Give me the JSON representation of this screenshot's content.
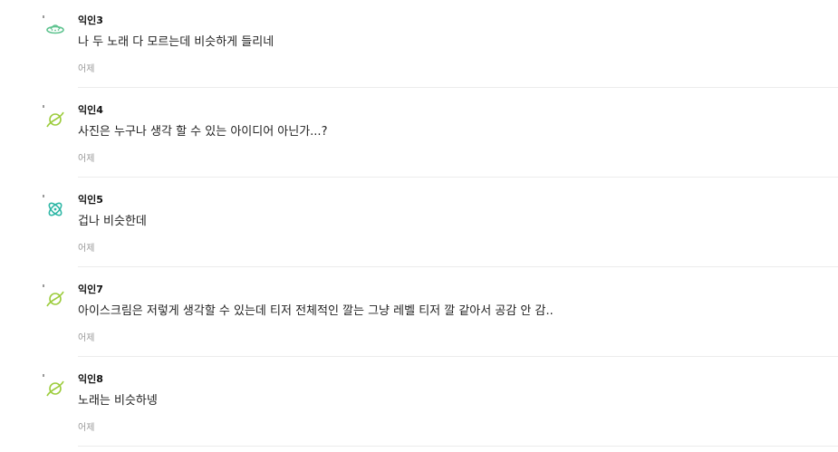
{
  "comments": [
    {
      "author": "익인3",
      "text": "나 두 노래 다 모르는데 비슷하게 들리네",
      "time": "어제",
      "icon": "ufo-icon",
      "icon_color": "#5ec38f"
    },
    {
      "author": "익인4",
      "text": "사진은 누구나 생각 할 수 있는 아이디어 아닌가...?",
      "time": "어제",
      "icon": "planet-icon",
      "icon_color": "#9ccc3c"
    },
    {
      "author": "익인5",
      "text": "겁나 비슷한데",
      "time": "어제",
      "icon": "atom-icon",
      "icon_color": "#2fb7a6"
    },
    {
      "author": "익인7",
      "text": "아이스크림은 저렇게 생각할 수 있는데 티저 전체적인 깔는 그냥 레벨 티저 깔 같아서 공감 안 감..",
      "time": "어제",
      "icon": "planet-icon",
      "icon_color": "#9ccc3c"
    },
    {
      "author": "익인8",
      "text": "노래는 비슷하넹",
      "time": "어제",
      "icon": "planet-icon",
      "icon_color": "#9ccc3c"
    }
  ],
  "colors": {
    "divider": "#ececec",
    "time_text": "#999999",
    "author_text": "#111111"
  }
}
